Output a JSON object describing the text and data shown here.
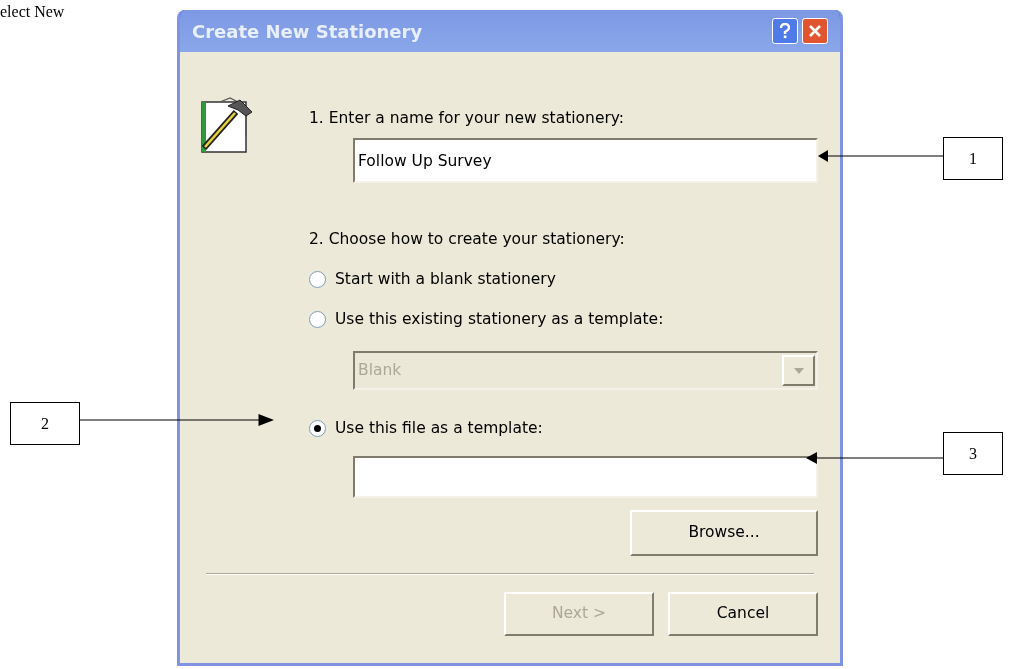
{
  "page_text": "elect New",
  "dialog": {
    "title": "Create New Stationery",
    "step1_label": "1. Enter a name for your new stationery:",
    "name_field": {
      "value": "Follow Up Survey"
    },
    "step2_label": "2. Choose how to create your stationery:",
    "options": [
      {
        "kind": "plain",
        "label": "Start with a blank stationery",
        "selected": false
      },
      {
        "kind": "select",
        "label": "Use this existing stationery as a template:",
        "selected": false
      },
      {
        "kind": "file",
        "label": "Use this file as a template:",
        "selected": true
      }
    ],
    "template_select": {
      "value": "Blank",
      "disabled": true
    },
    "browse_button": "Browse...",
    "buttons": [
      {
        "label": "Next >",
        "disabled": true
      },
      {
        "label": "Cancel",
        "disabled": false
      }
    ]
  },
  "callouts": [
    {
      "label": "1"
    },
    {
      "label": "2"
    },
    {
      "label": "3"
    }
  ]
}
